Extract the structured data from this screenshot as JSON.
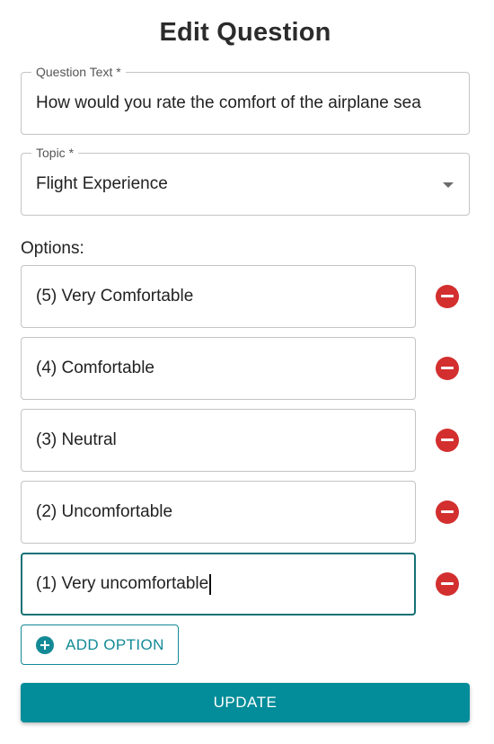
{
  "page": {
    "title": "Edit Question"
  },
  "question_text": {
    "label": "Question Text *",
    "value": "How would you rate the comfort of the airplane sea"
  },
  "topic": {
    "label": "Topic *",
    "value": "Flight Experience"
  },
  "options": {
    "label": "Options:",
    "items": [
      {
        "value": "(5) Very Comfortable"
      },
      {
        "value": "(4) Comfortable"
      },
      {
        "value": "(3) Neutral"
      },
      {
        "value": "(2) Uncomfortable"
      },
      {
        "value": "(1) Very uncomfortable",
        "focused": true
      }
    ]
  },
  "actions": {
    "add_option_label": "ADD OPTION",
    "update_label": "UPDATE"
  },
  "colors": {
    "accent": "#038c99",
    "remove": "#d32f2f",
    "focus_border": "#157177"
  },
  "icons": {
    "remove": "minus-circle-icon",
    "add": "plus-circle-icon",
    "dropdown": "dropdown-arrow-icon"
  }
}
